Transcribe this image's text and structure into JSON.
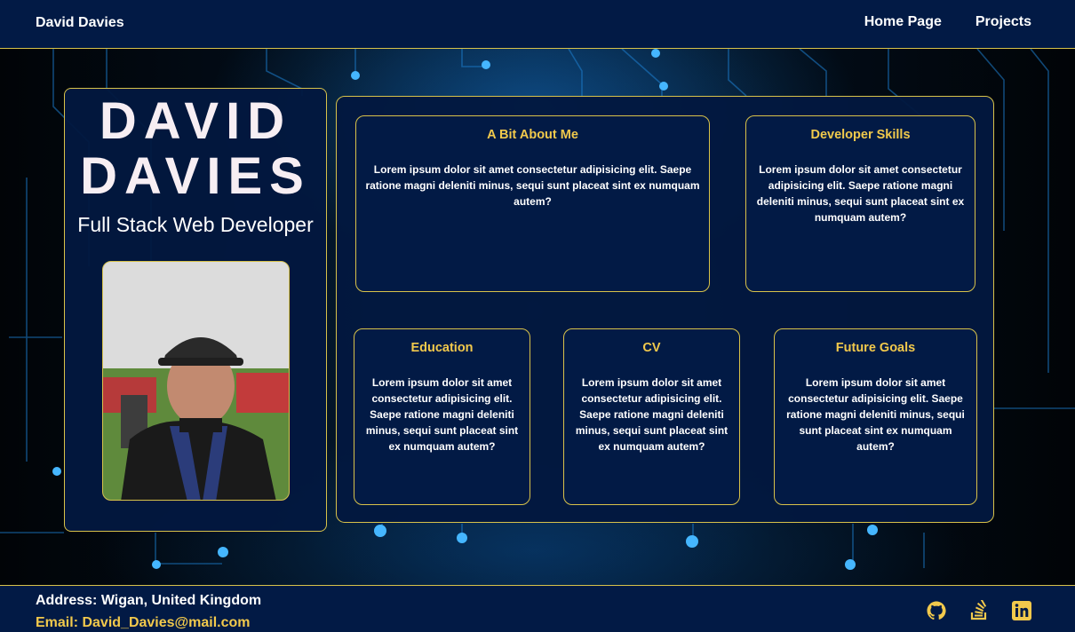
{
  "header": {
    "brand": "David Davies",
    "nav": [
      "Home Page",
      "Projects"
    ]
  },
  "profile": {
    "name_line1": "DAVID",
    "name_line2": "DAVIES",
    "role": "Full Stack Web Developer"
  },
  "cards": [
    {
      "title": "A Bit About Me",
      "text": "Lorem ipsum dolor sit amet consectetur adipisicing elit. Saepe ratione magni deleniti minus, sequi sunt placeat sint ex numquam autem?"
    },
    {
      "title": "Developer Skills",
      "text": "Lorem ipsum dolor sit amet consectetur adipisicing elit. Saepe ratione magni deleniti minus, sequi sunt placeat sint ex numquam autem?"
    },
    {
      "title": "Education",
      "text": "Lorem ipsum dolor sit amet consectetur adipisicing elit. Saepe ratione magni deleniti minus, sequi sunt placeat sint ex numquam autem?"
    },
    {
      "title": "CV",
      "text": "Lorem ipsum dolor sit amet consectetur adipisicing elit. Saepe ratione magni deleniti minus, sequi sunt placeat sint ex numquam autem?"
    },
    {
      "title": "Future Goals",
      "text": "Lorem ipsum dolor sit amet consectetur adipisicing elit. Saepe ratione magni deleniti minus, sequi sunt placeat sint ex numquam autem?"
    }
  ],
  "footer": {
    "address_label": "Address:",
    "address_value": "Wigan, United Kingdom",
    "email_label": "Email:",
    "email_value": "David_Davies@mail.com",
    "socials": [
      "github-icon",
      "stack-overflow-icon",
      "linkedin-icon"
    ]
  },
  "colors": {
    "accent": "#f2c94c",
    "border": "#d8c24a",
    "navy": "#021a45"
  }
}
